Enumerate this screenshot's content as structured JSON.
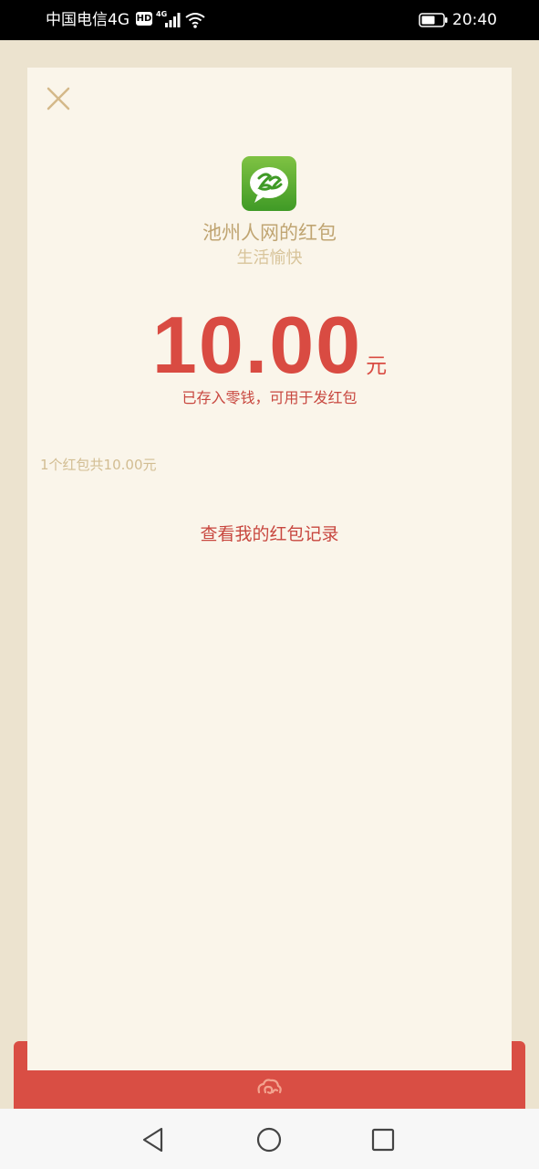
{
  "status_bar": {
    "carrier": "中国电信4G",
    "hd_badge": "HD",
    "signal_label": "4G",
    "time": "20:40",
    "icons": [
      "hd-icon",
      "signal-icon",
      "wifi-icon",
      "battery-icon"
    ]
  },
  "card": {
    "close_icon": "close-icon",
    "app_logo_icon": "app-logo-icon",
    "sender_name": "池州人网的红包",
    "wish": "生活愉快",
    "amount": "10.00",
    "currency_unit": "元",
    "amount_note": "已存入零钱，可用于发红包",
    "summary": "1个红包共10.00元",
    "records_link": "查看我的红包记录"
  },
  "envelope": {
    "icon": "cloud-swirl-icon"
  },
  "nav_bar": {
    "icons": [
      "back-icon",
      "home-icon",
      "recent-apps-icon"
    ]
  },
  "colors": {
    "background": "#ece3cf",
    "card": "#faf5ea",
    "accent_red": "#d94b42",
    "gold_text": "#c0a572",
    "light_gold_text": "#d8c49a"
  }
}
